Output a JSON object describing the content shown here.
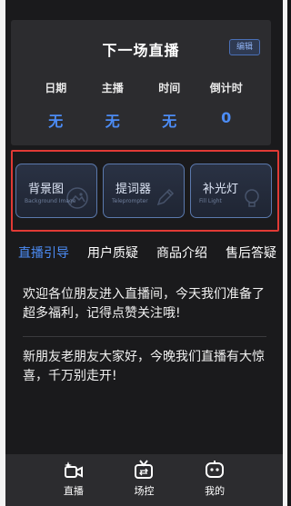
{
  "live_card": {
    "title": "下一场直播",
    "edit_label": "编辑",
    "columns": [
      {
        "header": "日期",
        "value": "无"
      },
      {
        "header": "主播",
        "value": "无"
      },
      {
        "header": "时间",
        "value": "无"
      },
      {
        "header": "倒计时",
        "value": "0"
      }
    ]
  },
  "tools": [
    {
      "label": "背景图",
      "sublabel": "Background Image",
      "icon": "image-icon"
    },
    {
      "label": "提词器",
      "sublabel": "Teleprompter",
      "icon": "pen-icon"
    },
    {
      "label": "补光灯",
      "sublabel": "Fill Light",
      "icon": "bulb-icon"
    }
  ],
  "tabs": [
    {
      "label": "直播引导",
      "active": true
    },
    {
      "label": "用户质疑",
      "active": false
    },
    {
      "label": "商品介绍",
      "active": false
    },
    {
      "label": "售后答疑",
      "active": false
    }
  ],
  "messages": [
    "欢迎各位朋友进入直播间，今天我们准备了超多福利，记得点赞关注哦!",
    "新朋友老朋友大家好，今晚我们直播有大惊喜，千万别走开!"
  ],
  "nav": [
    {
      "label": "直播",
      "icon": "live-camera-icon"
    },
    {
      "label": "场控",
      "icon": "tv-icon"
    },
    {
      "label": "我的",
      "icon": "robot-face-icon"
    }
  ],
  "colors": {
    "accent": "#4c8cf5",
    "highlight_box": "#e13a35",
    "background": "#1a1a1c",
    "card": "#2c2c2f"
  }
}
